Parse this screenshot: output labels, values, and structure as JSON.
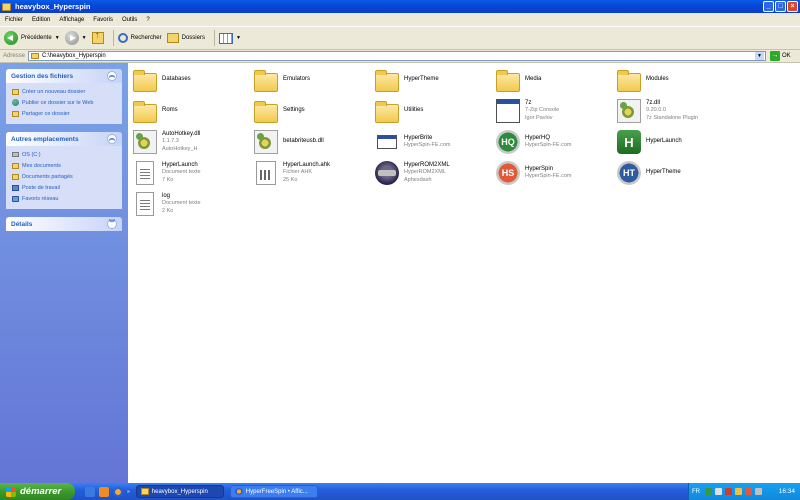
{
  "window": {
    "title": "heavybox_Hyperspin",
    "controls": [
      "_",
      "□",
      "×"
    ]
  },
  "menu": [
    "Fichier",
    "Edition",
    "Affichage",
    "Favoris",
    "Outils",
    "?"
  ],
  "toolbar": {
    "back_label": "Précédente",
    "search_label": "Rechercher",
    "folders_label": "Dossiers"
  },
  "address": {
    "label": "Adresse",
    "value": "C:\\heavybox_Hyperspin",
    "go_label": "OK"
  },
  "sidebar": {
    "file_tasks": {
      "title": "Gestion des fichiers",
      "items": [
        {
          "label": "Créer un nouveau dossier",
          "icon": "new-folder-icon"
        },
        {
          "label": "Publier ce dossier sur le Web",
          "icon": "globe-icon"
        },
        {
          "label": "Partager ce dossier",
          "icon": "share-folder-icon"
        }
      ]
    },
    "other_places": {
      "title": "Autres emplacements",
      "items": [
        {
          "label": "OS (C:)",
          "icon": "drive-icon"
        },
        {
          "label": "Mes documents",
          "icon": "folder-icon"
        },
        {
          "label": "Documents partagés",
          "icon": "folder-icon"
        },
        {
          "label": "Poste de travail",
          "icon": "computer-icon"
        },
        {
          "label": "Favoris réseau",
          "icon": "network-icon"
        }
      ]
    },
    "details": {
      "title": "Détails"
    }
  },
  "files": [
    {
      "name": "Databases",
      "sub1": "",
      "sub2": "",
      "icon": "folder"
    },
    {
      "name": "Emulators",
      "sub1": "",
      "sub2": "",
      "icon": "folder"
    },
    {
      "name": "HyperTheme",
      "sub1": "",
      "sub2": "",
      "icon": "folder"
    },
    {
      "name": "Media",
      "sub1": "",
      "sub2": "",
      "icon": "folder"
    },
    {
      "name": "Modules",
      "sub1": "",
      "sub2": "",
      "icon": "folder"
    },
    {
      "name": "Roms",
      "sub1": "",
      "sub2": "",
      "icon": "folder"
    },
    {
      "name": "Settings",
      "sub1": "",
      "sub2": "",
      "icon": "folder"
    },
    {
      "name": "Utilities",
      "sub1": "",
      "sub2": "",
      "icon": "folder"
    },
    {
      "name": "7z",
      "sub1": "7-Zip Console",
      "sub2": "Igor Pavlov",
      "icon": "appwin"
    },
    {
      "name": "7z.dll",
      "sub1": "9.20.0.0",
      "sub2": "7z Standalone Plugin",
      "icon": "dll"
    },
    {
      "name": "AutoHotkey.dll",
      "sub1": "1.1.7.3",
      "sub2": "AutoHotkey_H",
      "icon": "dll"
    },
    {
      "name": "betabriteusb.dll",
      "sub1": "",
      "sub2": "",
      "icon": "dll"
    },
    {
      "name": "HyperBrite",
      "sub1": "HyperSpin-FE.com",
      "sub2": "",
      "icon": "appwinsmall"
    },
    {
      "name": "HyperHQ",
      "sub1": "HyperSpin-FE.com",
      "sub2": "",
      "icon": "hq"
    },
    {
      "name": "HyperLaunch",
      "sub1": "",
      "sub2": "",
      "icon": "hl"
    },
    {
      "name": "HyperLaunch",
      "sub1": "Document texte",
      "sub2": "7 Ko",
      "icon": "doc"
    },
    {
      "name": "HyperLaunch.ahk",
      "sub1": "Fichier AHK",
      "sub2": "25 Ko",
      "icon": "ahk"
    },
    {
      "name": "HyperROM2XML",
      "sub1": "HyperROM2XML",
      "sub2": "Aphexdash",
      "icon": "rom"
    },
    {
      "name": "HyperSpin",
      "sub1": "HyperSpin-FE.com",
      "sub2": "",
      "icon": "hs"
    },
    {
      "name": "HyperTheme",
      "sub1": "",
      "sub2": "",
      "icon": "ht"
    },
    {
      "name": "log",
      "sub1": "Document texte",
      "sub2": "2 Ko",
      "icon": "doc"
    }
  ],
  "icon_glyphs": {
    "hq": "HQ",
    "hl": "H",
    "hs": "HS",
    "ht": "HT"
  },
  "taskbar": {
    "start_label": "démarrer",
    "tasks": [
      {
        "label": "heavybox_Hyperspin",
        "active": true
      },
      {
        "label": "HyperFreeSpin • Affic...",
        "active": false
      }
    ],
    "tray": {
      "lang": "FR",
      "clock": "16:34"
    }
  },
  "colors": {
    "titlebar": "#0a5ce8",
    "sidebar": "#7ba2e7",
    "link": "#215dc6",
    "start": "#3c9a2c",
    "taskbar": "#245edb"
  }
}
